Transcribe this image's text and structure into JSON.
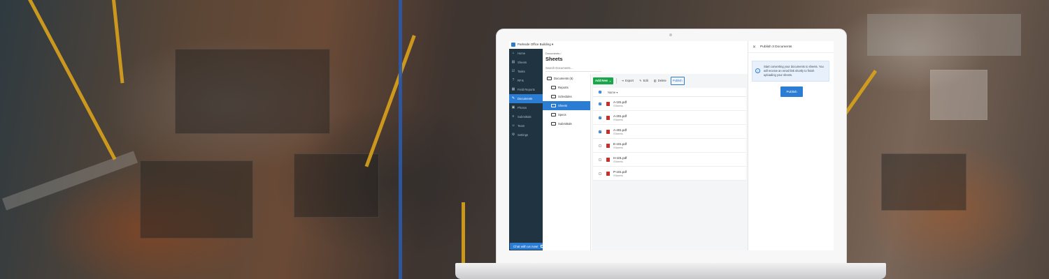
{
  "project": {
    "name": "Parkside Office Building ▾"
  },
  "sidebar": {
    "items": [
      {
        "label": "Home",
        "icon": "home-icon",
        "glyph": "⌂"
      },
      {
        "label": "Sheets",
        "icon": "sheets-icon",
        "glyph": "▤"
      },
      {
        "label": "Tasks",
        "icon": "tasks-icon",
        "glyph": "☑"
      },
      {
        "label": "RFIs",
        "icon": "rfis-icon",
        "glyph": "?"
      },
      {
        "label": "Field Reports",
        "icon": "field-reports-icon",
        "glyph": "▦"
      },
      {
        "label": "Documents",
        "icon": "documents-icon",
        "glyph": "✎"
      },
      {
        "label": "Photos",
        "icon": "photos-icon",
        "glyph": "▣"
      },
      {
        "label": "Submittals",
        "icon": "submittals-icon",
        "glyph": "≡"
      },
      {
        "label": "Team",
        "icon": "team-icon",
        "glyph": "☺"
      },
      {
        "label": "Settings",
        "icon": "settings-icon",
        "glyph": "⚙"
      }
    ],
    "chat_label": "Chat with us now!"
  },
  "main": {
    "breadcrumb": "Documents /",
    "title": "Sheets",
    "search_placeholder": "Search Documents..."
  },
  "tree": {
    "root": "Documents (6)",
    "folders": [
      "Reports",
      "Schedules",
      "Sheets",
      "Specs",
      "Submittals"
    ]
  },
  "toolbar": {
    "add_new": "Add New",
    "export": "Export",
    "edit": "Edit",
    "delete": "Delete",
    "publish": "Publish"
  },
  "table": {
    "header": "Name ▾",
    "rows": [
      {
        "name": "A-101.pdf",
        "path": "/Sheets",
        "checked": true
      },
      {
        "name": "A-201.pdf",
        "path": "/Sheets",
        "checked": true
      },
      {
        "name": "A-401.pdf",
        "path": "/Sheets",
        "checked": true
      },
      {
        "name": "E-101.pdf",
        "path": "/Sheets",
        "checked": false
      },
      {
        "name": "H-101.pdf",
        "path": "/Sheets",
        "checked": false
      },
      {
        "name": "P-101.pdf",
        "path": "/Sheets",
        "checked": false
      }
    ]
  },
  "panel": {
    "title": "Publish 3 Documents",
    "info": "Start converting your documents to sheets. You will receive an email link shortly to finish uploading your sheets.",
    "button": "Publish"
  },
  "colors": {
    "accent": "#2b7cd3",
    "success": "#1aa64a",
    "sidebar": "#1f3340",
    "pdf": "#c4302b"
  }
}
